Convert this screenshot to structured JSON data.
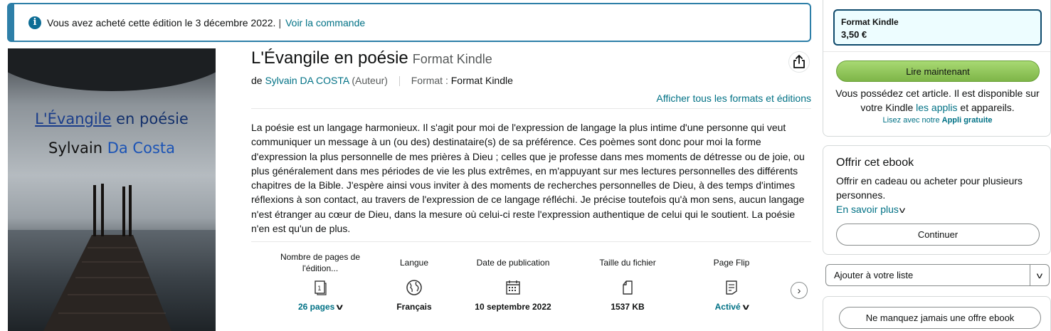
{
  "banner": {
    "icon": "info-icon",
    "text": "Vous avez acheté cette édition le 3 décembre 2022.",
    "separator": "|",
    "link": "Voir la commande"
  },
  "cover": {
    "title_underlined": "L'Évangile",
    "title_rest": " en poésie",
    "author_first": "Sylvain ",
    "author_last": "Da Costa"
  },
  "product": {
    "title": "L'Évangile en poésie",
    "format_label": "Format Kindle",
    "by": "de",
    "author": "Sylvain DA COSTA",
    "role": "(Auteur)",
    "format_key": "Format :",
    "format_value": "Format Kindle",
    "all_formats_link": "Afficher tous les formats et éditions",
    "description": "La poésie est un langage harmonieux. Il s'agit pour moi de l'expression de langage la plus intime d'une personne qui veut communiquer un message à un (ou des) destinataire(s) de sa préférence. Ces poèmes sont donc pour moi la forme d'expression la plus personnelle de mes prières à Dieu ; celles que je professe dans mes moments de détresse ou de joie, ou plus généralement dans mes périodes de vie les plus extrêmes, en m'appuyant sur mes lectures personnelles des différents chapitres de la Bible. J'espère ainsi vous inviter à des moments de recherches personnelles de Dieu, à des temps d'intimes réflexions à son contact, au travers de l'expression de ce langage réfléchi. Je précise toutefois qu'à mon sens, aucun langage n'est étranger au cœur de Dieu, dans la mesure où celui-ci reste l'expression authentique de celui qui le soutient. La poésie n'en est qu'un de plus."
  },
  "attributes": [
    {
      "label": "Nombre de pages de l'édition...",
      "icon": "book-pages-icon",
      "value": "26 pages",
      "link": true
    },
    {
      "label": "Langue",
      "icon": "globe-icon",
      "value": "Français",
      "link": false
    },
    {
      "label": "Date de publication",
      "icon": "calendar-icon",
      "value": "10 septembre 2022",
      "link": false
    },
    {
      "label": "Taille du fichier",
      "icon": "file-icon",
      "value": "1537 KB",
      "link": false
    },
    {
      "label": "Page Flip",
      "icon": "page-flip-icon",
      "value": "Activé",
      "link": true
    }
  ],
  "buybox": {
    "format_name": "Format Kindle",
    "price": "3,50 €",
    "read_now": "Lire maintenant",
    "owned_text_1": "Vous possédez cet article. Il est disponible sur votre Kindle",
    "owned_link": "les applis",
    "owned_text_2": "et appareils.",
    "apps_note_1": "Lisez avec notre",
    "apps_note_2": "Appli gratuite"
  },
  "gift": {
    "title": "Offrir cet ebook",
    "text": "Offrir en cadeau ou acheter pour plusieurs personnes.",
    "more": "En savoir plus",
    "continue": "Continuer"
  },
  "wishlist": {
    "label": "Ajouter à votre liste"
  },
  "deals": {
    "label": "Ne manquez jamais une offre ebook"
  },
  "colors": {
    "link": "#007185",
    "banner_border": "#2e7fa8",
    "read_button": "#8cc652",
    "format_box_bg": "#edfdff"
  }
}
